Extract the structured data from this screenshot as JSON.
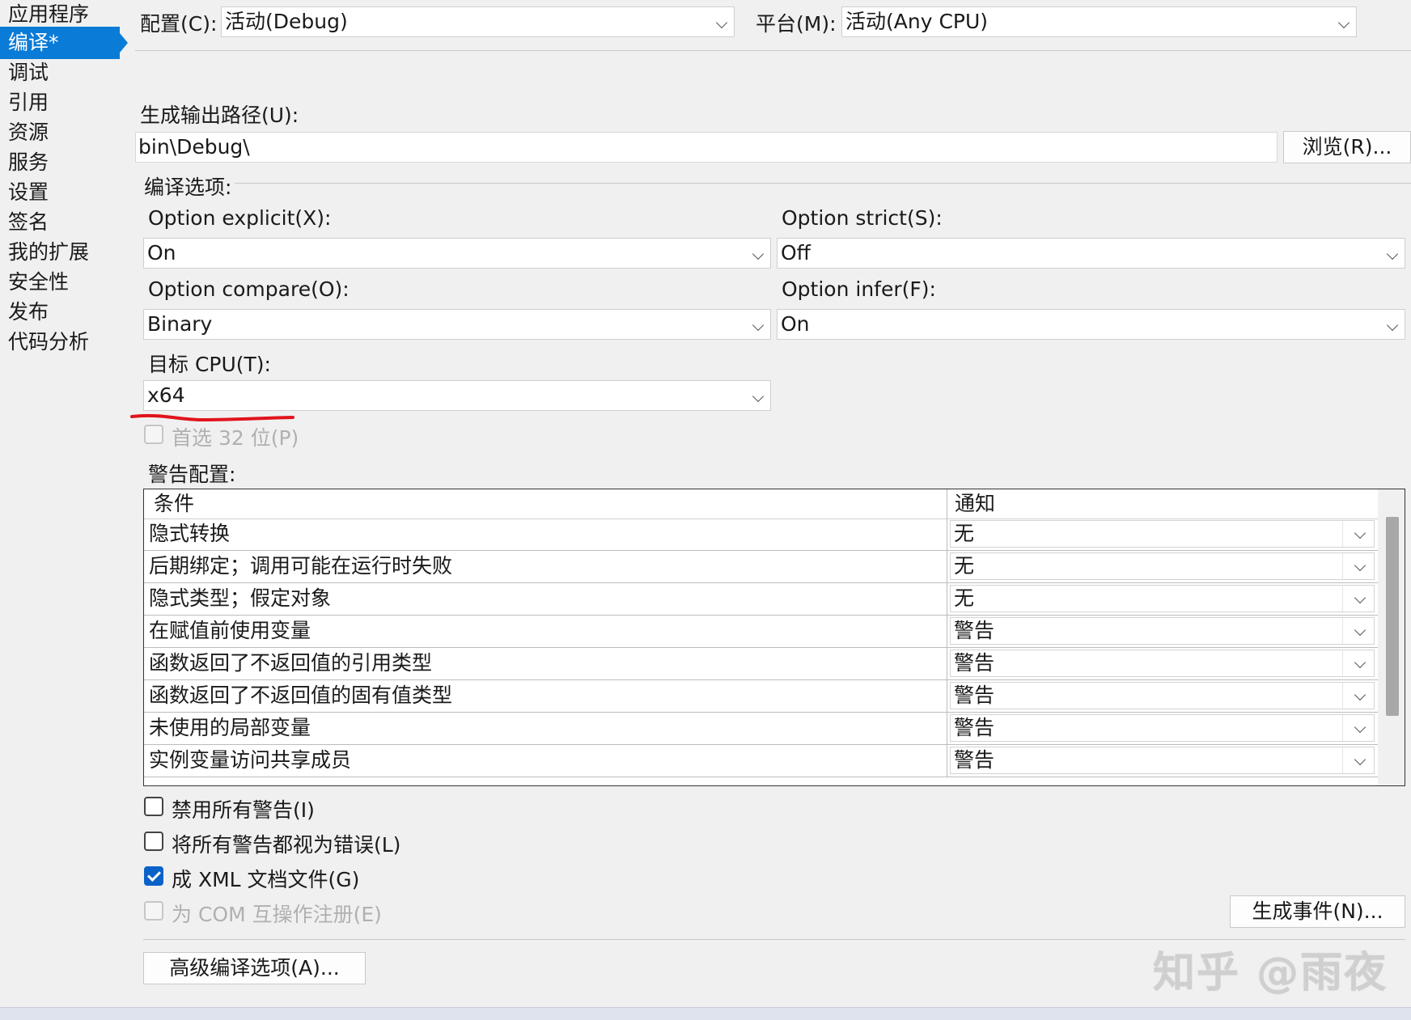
{
  "sidebar": {
    "items": [
      {
        "label": "应用程序"
      },
      {
        "label": "编译*"
      },
      {
        "label": "调试"
      },
      {
        "label": "引用"
      },
      {
        "label": "资源"
      },
      {
        "label": "服务"
      },
      {
        "label": "设置"
      },
      {
        "label": "签名"
      },
      {
        "label": "我的扩展"
      },
      {
        "label": "安全性"
      },
      {
        "label": "发布"
      },
      {
        "label": "代码分析"
      }
    ],
    "selected_index": 1,
    "selected_color": "#0a7bd6"
  },
  "config": {
    "label": "配置(C):",
    "value": "活动(Debug)"
  },
  "platform": {
    "label": "平台(M):",
    "value": "活动(Any CPU)"
  },
  "output_path": {
    "label": "生成输出路径(U):",
    "value": "bin\\Debug\\",
    "browse_label": "浏览(R)..."
  },
  "compile_options": {
    "label": "编译选项:",
    "option_explicit": {
      "label": "Option explicit(X):",
      "value": "On"
    },
    "option_strict": {
      "label": "Option strict(S):",
      "value": "Off"
    },
    "option_compare": {
      "label": "Option compare(O):",
      "value": "Binary"
    },
    "option_infer": {
      "label": "Option infer(F):",
      "value": "On"
    },
    "target_cpu": {
      "label": "目标 CPU(T):",
      "value": "x64"
    },
    "prefer_32bit": {
      "label": "首选 32 位(P)",
      "checked": false,
      "enabled": false
    }
  },
  "warnings": {
    "label": "警告配置:",
    "columns": {
      "condition": "条件",
      "notify": "通知"
    },
    "rows": [
      {
        "condition": "隐式转换",
        "notify": "无"
      },
      {
        "condition": "后期绑定；调用可能在运行时失败",
        "notify": "无"
      },
      {
        "condition": "隐式类型；假定对象",
        "notify": "无"
      },
      {
        "condition": "在赋值前使用变量",
        "notify": "警告"
      },
      {
        "condition": "函数返回了不返回值的引用类型",
        "notify": "警告"
      },
      {
        "condition": "函数返回了不返回值的固有值类型",
        "notify": "警告"
      },
      {
        "condition": "未使用的局部变量",
        "notify": "警告"
      },
      {
        "condition": "实例变量访问共享成员",
        "notify": "警告"
      }
    ]
  },
  "checkboxes": {
    "disable_all": {
      "label": "禁用所有警告(I)",
      "checked": false,
      "enabled": true
    },
    "treat_as_errors": {
      "label": "将所有警告都视为错误(L)",
      "checked": false,
      "enabled": true
    },
    "xml_doc": {
      "label": "成 XML 文档文件(G)",
      "checked": true,
      "enabled": true
    },
    "com_interop": {
      "label": "为 COM 互操作注册(E)",
      "checked": false,
      "enabled": false
    }
  },
  "buttons": {
    "build_events": "生成事件(N)...",
    "advanced": "高级编译选项(A)..."
  },
  "annotation_color": "#e0141b",
  "watermark": "知乎 @雨夜"
}
